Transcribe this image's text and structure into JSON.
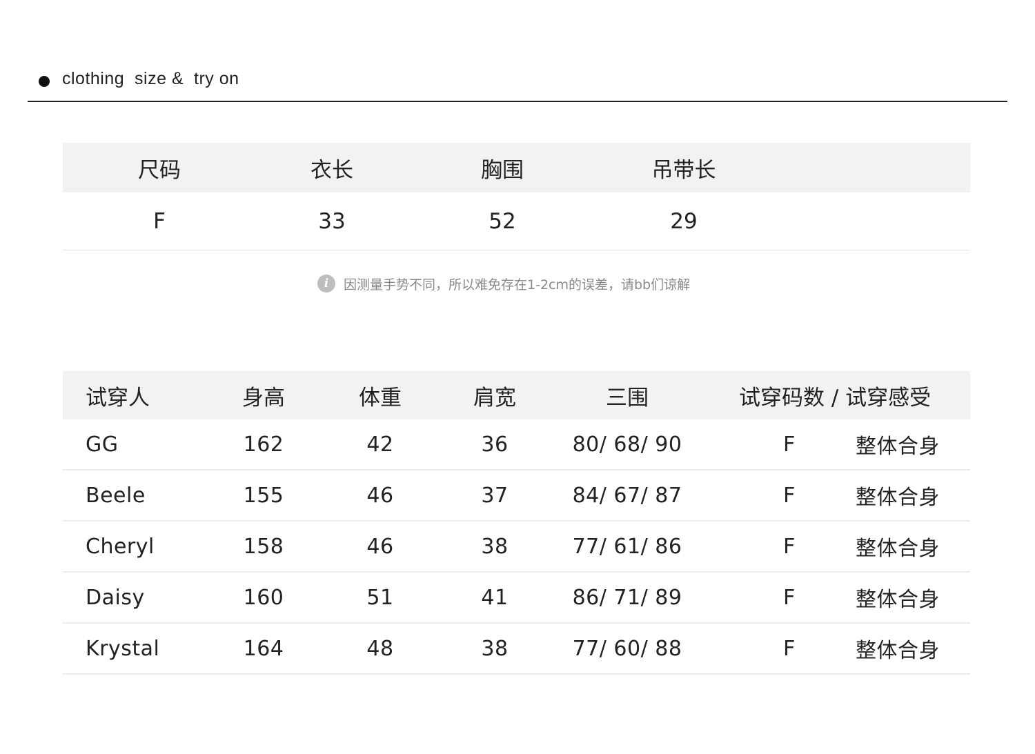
{
  "header": {
    "title": "clothing  size &  try on"
  },
  "size_table": {
    "columns": [
      "尺码",
      "衣长",
      "胸围",
      "吊带长"
    ],
    "rows": [
      [
        "F",
        "33",
        "52",
        "29"
      ]
    ]
  },
  "note": {
    "icon": "info-icon",
    "icon_glyph": "i",
    "text": "因测量手势不同，所以难免存在1-2cm的误差，请bb们谅解"
  },
  "try_on_table": {
    "columns": [
      "试穿人",
      "身高",
      "体重",
      "肩宽",
      "三围",
      "试穿码数 / 试穿感受"
    ],
    "rows": [
      {
        "name": "GG",
        "height": "162",
        "weight": "42",
        "shoulder": "36",
        "measurements": "80/ 68/ 90",
        "size": "F",
        "feeling": "整体合身"
      },
      {
        "name": "Beele",
        "height": "155",
        "weight": "46",
        "shoulder": "37",
        "measurements": "84/ 67/ 87",
        "size": "F",
        "feeling": "整体合身"
      },
      {
        "name": "Cheryl",
        "height": "158",
        "weight": "46",
        "shoulder": "38",
        "measurements": "77/ 61/ 86",
        "size": "F",
        "feeling": "整体合身"
      },
      {
        "name": "Daisy",
        "height": "160",
        "weight": "51",
        "shoulder": "41",
        "measurements": "86/ 71/ 89",
        "size": "F",
        "feeling": "整体合身"
      },
      {
        "name": "Krystal",
        "height": "164",
        "weight": "48",
        "shoulder": "38",
        "measurements": "77/ 60/ 88",
        "size": "F",
        "feeling": "整体合身"
      }
    ]
  }
}
